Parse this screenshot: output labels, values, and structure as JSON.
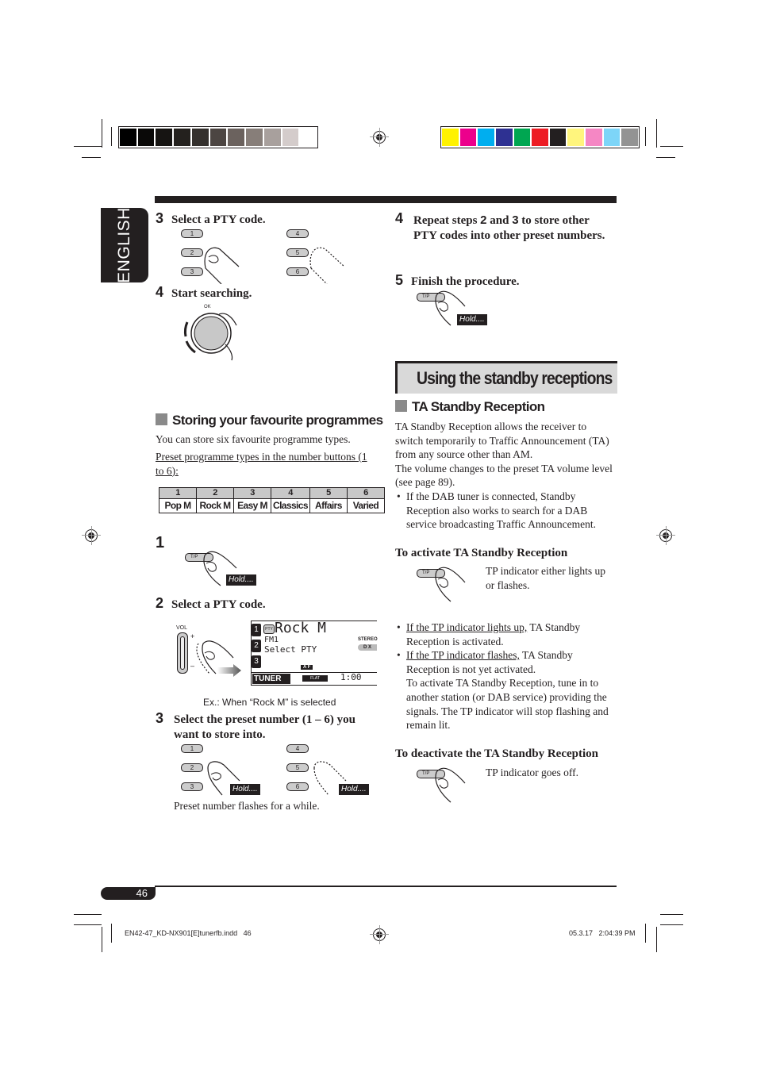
{
  "print_marks": {
    "gray_swatches": [
      "#000000",
      "#0a0908",
      "#161412",
      "#24211e",
      "#34302d",
      "#4c4542",
      "#6b625e",
      "#877e79",
      "#a8a09d",
      "#d4cccb",
      "#ffffff"
    ],
    "color_swatches": [
      "#fff200",
      "#ec008c",
      "#00aeef",
      "#2e3192",
      "#00a651",
      "#ed1c24",
      "#231f20",
      "#fff57d",
      "#f587c4",
      "#7dd5f8",
      "#939393"
    ]
  },
  "language_tab": "ENGLISH",
  "left_column": {
    "step3a": {
      "num": "3",
      "text": "Select a PTY code.",
      "buttons": [
        "1",
        "2",
        "3",
        "4",
        "5",
        "6"
      ]
    },
    "step4a": {
      "num": "4",
      "text": "Start searching.",
      "dial_label": "OK"
    },
    "section_title": "Storing your favourite programmes",
    "intro": "You can store six favourite programme types.",
    "preset_caption": "Preset programme types in the number buttons (1 to 6):",
    "preset_table": {
      "numbers": [
        "1",
        "2",
        "3",
        "4",
        "5",
        "6"
      ],
      "names": [
        "Pop M",
        "Rock M",
        "Easy M",
        "Classics",
        "Affairs",
        "Varied"
      ]
    },
    "step1": {
      "num": "1",
      "button": "T/P",
      "hold": "Hold...."
    },
    "step2": {
      "num": "2",
      "text": "Select a PTY code.",
      "vol_label": "VOL",
      "plus": "+",
      "minus": "–"
    },
    "display": {
      "presets": [
        "1",
        "2",
        "3"
      ],
      "pty_badge": "PTY",
      "main_text": "Rock M",
      "band": "FM1",
      "sub_text": "Select PTY",
      "stereo": "STEREO",
      "dx": "D X",
      "af": "A F",
      "source": "TUNER",
      "eq": "FLAT",
      "clock": "1:00"
    },
    "display_caption": "Ex.: When “Rock M” is selected",
    "step3b": {
      "num": "3",
      "text": "Select the preset number (1 – 6) you want to store into.",
      "buttons": [
        "1",
        "2",
        "3",
        "4",
        "5",
        "6"
      ],
      "hold": "Hold....",
      "note": "Preset number flashes for a while."
    }
  },
  "right_column": {
    "step4b": {
      "num": "4",
      "text_pre": "Repeat steps ",
      "s2": "2",
      "mid": " and ",
      "s3": "3",
      "text_post": " to store other PTY codes into other preset numbers."
    },
    "step5": {
      "num": "5",
      "text": "Finish the procedure.",
      "button": "T/P",
      "hold": "Hold...."
    },
    "banner_title": "Using the standby receptions",
    "section_title": "TA Standby Reception",
    "para1": "TA Standby Reception allows the receiver to switch temporarily to Traffic Announcement (TA) from any source other than AM.",
    "para2": "The volume changes to the preset TA volume level (see page 89).",
    "bullet_dab": "If the DAB tuner is connected, Standby Reception also works to search for a DAB service broadcasting Traffic Announcement.",
    "activate": {
      "title": "To activate TA Standby Reception",
      "button": "T/P",
      "result": "TP indicator either lights up or flashes."
    },
    "bullets": [
      {
        "underlined": "If the TP indicator lights up,",
        "rest": " TA Standby Reception is activated."
      },
      {
        "underlined": "If the TP indicator flashes,",
        "rest": " TA Standby Reception is not yet activated.",
        "extra": "To activate TA Standby Reception, tune in to another station (or DAB service) providing the signals. The TP indicator will stop flashing and remain lit."
      }
    ],
    "deactivate": {
      "title": "To deactivate the TA Standby Reception",
      "button": "T/P",
      "result": "TP indicator goes off."
    }
  },
  "footer": {
    "page_number": "46",
    "file_name": "EN42-47_KD-NX901[E]tunerfb.indd   46",
    "timestamp": "05.3.17   2:04:39 PM"
  }
}
